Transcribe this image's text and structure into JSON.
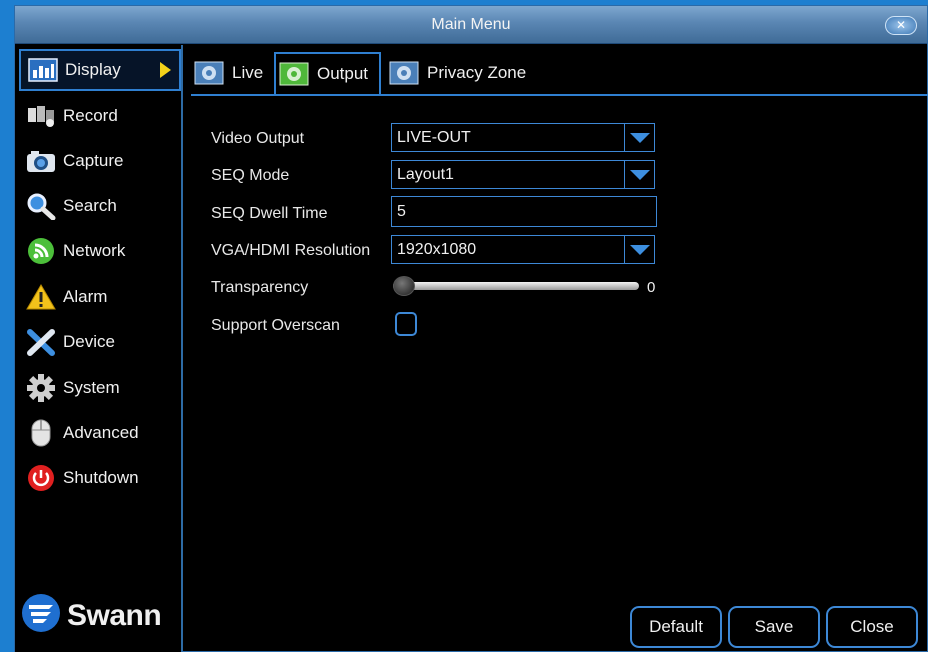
{
  "window": {
    "title": "Main Menu"
  },
  "sidebar": {
    "items": [
      {
        "label": "Display",
        "icon": "display-icon"
      },
      {
        "label": "Record",
        "icon": "record-icon"
      },
      {
        "label": "Capture",
        "icon": "camera-icon"
      },
      {
        "label": "Search",
        "icon": "search-icon"
      },
      {
        "label": "Network",
        "icon": "network-icon"
      },
      {
        "label": "Alarm",
        "icon": "alarm-icon"
      },
      {
        "label": "Device",
        "icon": "device-tools-icon"
      },
      {
        "label": "System",
        "icon": "gear-icon"
      },
      {
        "label": "Advanced",
        "icon": "mouse-icon"
      },
      {
        "label": "Shutdown",
        "icon": "power-icon"
      }
    ],
    "active": "Display",
    "logo": "Swann"
  },
  "tabs": [
    {
      "label": "Live"
    },
    {
      "label": "Output"
    },
    {
      "label": "Privacy Zone"
    }
  ],
  "active_tab": "Output",
  "form": {
    "video_output": {
      "label": "Video Output",
      "value": "LIVE-OUT"
    },
    "seq_mode": {
      "label": "SEQ Mode",
      "value": "Layout1"
    },
    "seq_dwell": {
      "label": "SEQ Dwell Time",
      "value": "5"
    },
    "resolution": {
      "label": "VGA/HDMI Resolution",
      "value": "1920x1080"
    },
    "transparency": {
      "label": "Transparency",
      "value": "0",
      "level": 0
    },
    "overscan": {
      "label": "Support Overscan",
      "checked": false
    }
  },
  "buttons": {
    "default": "Default",
    "save": "Save",
    "close": "Close"
  },
  "colors": {
    "accent": "#2f7fd0",
    "background": "#000000",
    "arrow": "#f4d21a"
  }
}
